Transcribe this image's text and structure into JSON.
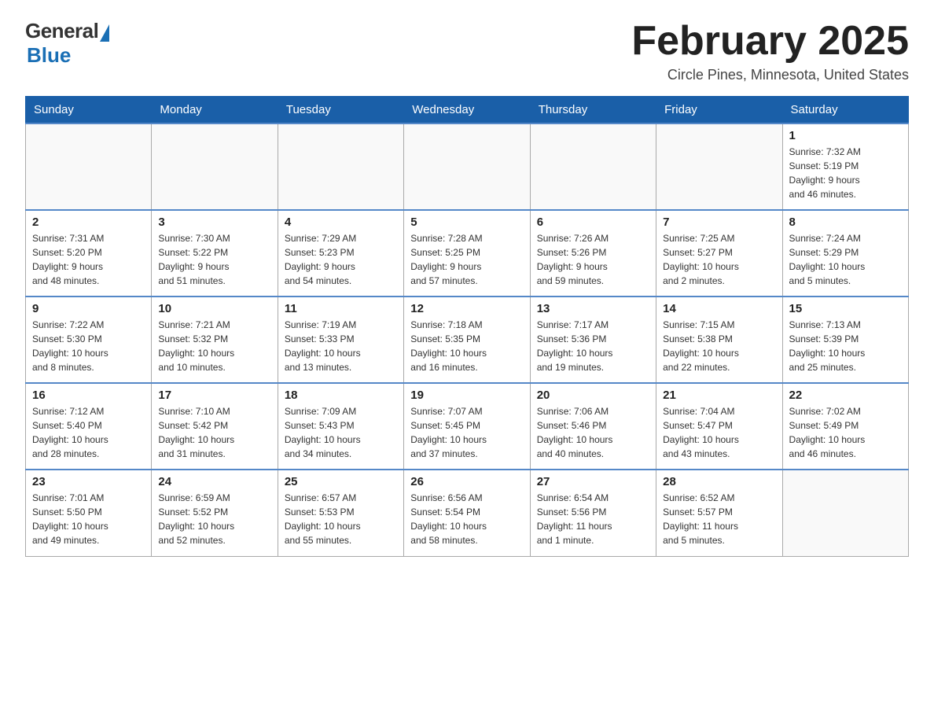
{
  "header": {
    "logo": {
      "general": "General",
      "blue": "Blue"
    },
    "title": "February 2025",
    "location": "Circle Pines, Minnesota, United States"
  },
  "days_of_week": [
    "Sunday",
    "Monday",
    "Tuesday",
    "Wednesday",
    "Thursday",
    "Friday",
    "Saturday"
  ],
  "weeks": [
    [
      {
        "day": "",
        "info": ""
      },
      {
        "day": "",
        "info": ""
      },
      {
        "day": "",
        "info": ""
      },
      {
        "day": "",
        "info": ""
      },
      {
        "day": "",
        "info": ""
      },
      {
        "day": "",
        "info": ""
      },
      {
        "day": "1",
        "info": "Sunrise: 7:32 AM\nSunset: 5:19 PM\nDaylight: 9 hours\nand 46 minutes."
      }
    ],
    [
      {
        "day": "2",
        "info": "Sunrise: 7:31 AM\nSunset: 5:20 PM\nDaylight: 9 hours\nand 48 minutes."
      },
      {
        "day": "3",
        "info": "Sunrise: 7:30 AM\nSunset: 5:22 PM\nDaylight: 9 hours\nand 51 minutes."
      },
      {
        "day": "4",
        "info": "Sunrise: 7:29 AM\nSunset: 5:23 PM\nDaylight: 9 hours\nand 54 minutes."
      },
      {
        "day": "5",
        "info": "Sunrise: 7:28 AM\nSunset: 5:25 PM\nDaylight: 9 hours\nand 57 minutes."
      },
      {
        "day": "6",
        "info": "Sunrise: 7:26 AM\nSunset: 5:26 PM\nDaylight: 9 hours\nand 59 minutes."
      },
      {
        "day": "7",
        "info": "Sunrise: 7:25 AM\nSunset: 5:27 PM\nDaylight: 10 hours\nand 2 minutes."
      },
      {
        "day": "8",
        "info": "Sunrise: 7:24 AM\nSunset: 5:29 PM\nDaylight: 10 hours\nand 5 minutes."
      }
    ],
    [
      {
        "day": "9",
        "info": "Sunrise: 7:22 AM\nSunset: 5:30 PM\nDaylight: 10 hours\nand 8 minutes."
      },
      {
        "day": "10",
        "info": "Sunrise: 7:21 AM\nSunset: 5:32 PM\nDaylight: 10 hours\nand 10 minutes."
      },
      {
        "day": "11",
        "info": "Sunrise: 7:19 AM\nSunset: 5:33 PM\nDaylight: 10 hours\nand 13 minutes."
      },
      {
        "day": "12",
        "info": "Sunrise: 7:18 AM\nSunset: 5:35 PM\nDaylight: 10 hours\nand 16 minutes."
      },
      {
        "day": "13",
        "info": "Sunrise: 7:17 AM\nSunset: 5:36 PM\nDaylight: 10 hours\nand 19 minutes."
      },
      {
        "day": "14",
        "info": "Sunrise: 7:15 AM\nSunset: 5:38 PM\nDaylight: 10 hours\nand 22 minutes."
      },
      {
        "day": "15",
        "info": "Sunrise: 7:13 AM\nSunset: 5:39 PM\nDaylight: 10 hours\nand 25 minutes."
      }
    ],
    [
      {
        "day": "16",
        "info": "Sunrise: 7:12 AM\nSunset: 5:40 PM\nDaylight: 10 hours\nand 28 minutes."
      },
      {
        "day": "17",
        "info": "Sunrise: 7:10 AM\nSunset: 5:42 PM\nDaylight: 10 hours\nand 31 minutes."
      },
      {
        "day": "18",
        "info": "Sunrise: 7:09 AM\nSunset: 5:43 PM\nDaylight: 10 hours\nand 34 minutes."
      },
      {
        "day": "19",
        "info": "Sunrise: 7:07 AM\nSunset: 5:45 PM\nDaylight: 10 hours\nand 37 minutes."
      },
      {
        "day": "20",
        "info": "Sunrise: 7:06 AM\nSunset: 5:46 PM\nDaylight: 10 hours\nand 40 minutes."
      },
      {
        "day": "21",
        "info": "Sunrise: 7:04 AM\nSunset: 5:47 PM\nDaylight: 10 hours\nand 43 minutes."
      },
      {
        "day": "22",
        "info": "Sunrise: 7:02 AM\nSunset: 5:49 PM\nDaylight: 10 hours\nand 46 minutes."
      }
    ],
    [
      {
        "day": "23",
        "info": "Sunrise: 7:01 AM\nSunset: 5:50 PM\nDaylight: 10 hours\nand 49 minutes."
      },
      {
        "day": "24",
        "info": "Sunrise: 6:59 AM\nSunset: 5:52 PM\nDaylight: 10 hours\nand 52 minutes."
      },
      {
        "day": "25",
        "info": "Sunrise: 6:57 AM\nSunset: 5:53 PM\nDaylight: 10 hours\nand 55 minutes."
      },
      {
        "day": "26",
        "info": "Sunrise: 6:56 AM\nSunset: 5:54 PM\nDaylight: 10 hours\nand 58 minutes."
      },
      {
        "day": "27",
        "info": "Sunrise: 6:54 AM\nSunset: 5:56 PM\nDaylight: 11 hours\nand 1 minute."
      },
      {
        "day": "28",
        "info": "Sunrise: 6:52 AM\nSunset: 5:57 PM\nDaylight: 11 hours\nand 5 minutes."
      },
      {
        "day": "",
        "info": ""
      }
    ]
  ]
}
